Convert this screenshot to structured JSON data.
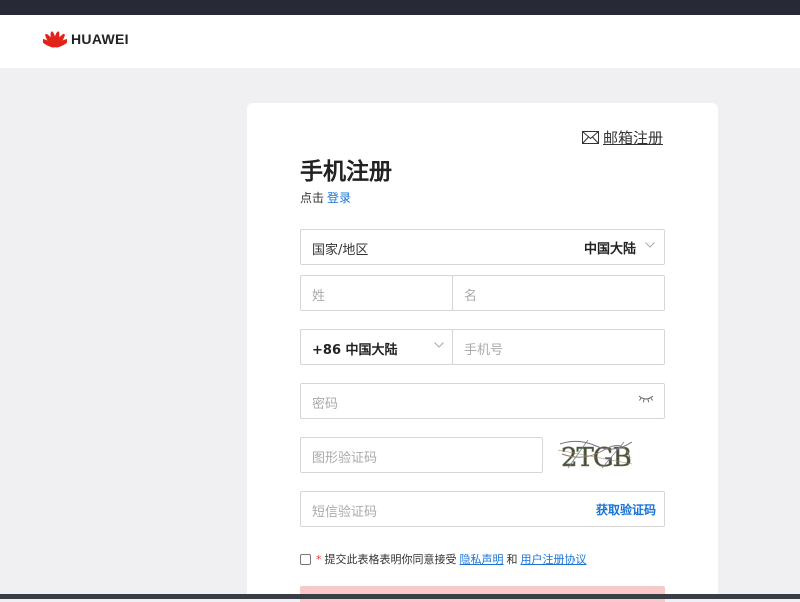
{
  "header": {
    "brand": "HUAWEI",
    "logo_color": "#e2231a"
  },
  "card": {
    "email_register_link": "邮箱注册",
    "title": "手机注册",
    "login_prompt": "点击",
    "login_link": "登录"
  },
  "form": {
    "country_label": "国家/地区",
    "country_value": "中国大陆",
    "surname_placeholder": "姓",
    "given_name_placeholder": "名",
    "country_code_value": "+86 中国大陆",
    "phone_placeholder": "手机号",
    "password_placeholder": "密码",
    "captcha_placeholder": "图形验证码",
    "captcha_text": "2TGB",
    "sms_placeholder": "短信验证码",
    "get_code_button": "获取验证码"
  },
  "agreement": {
    "required_mark": "*",
    "text": "提交此表格表明你同意接受",
    "privacy_link": "隐私声明",
    "and": "和",
    "terms_link": "用户注册协议"
  },
  "colors": {
    "link": "#1874d6",
    "submit_bg": "#f8c9c9",
    "page_bg": "#f0f0f2"
  }
}
